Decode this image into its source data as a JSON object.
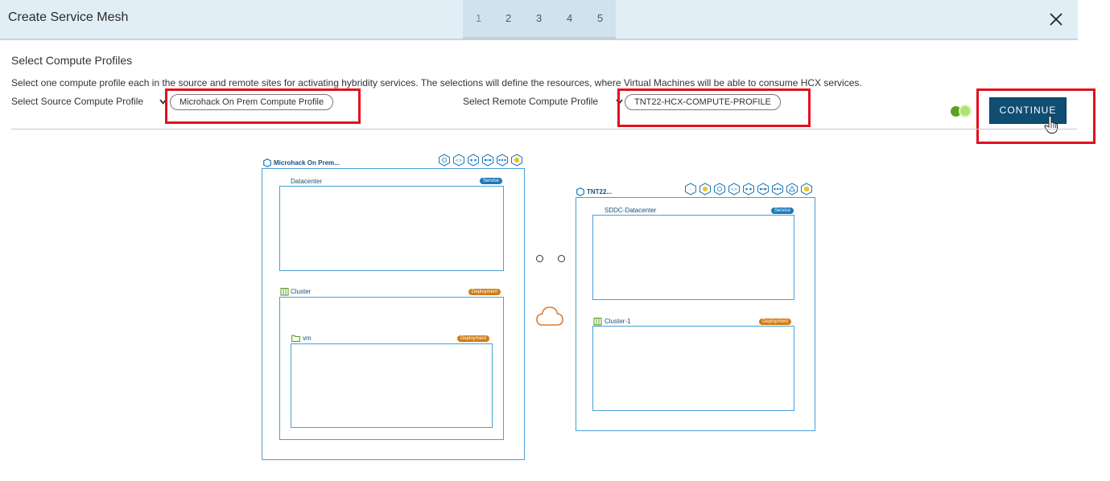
{
  "dialog": {
    "title": "Create Service Mesh",
    "steps": [
      "1",
      "2",
      "3",
      "4",
      "5"
    ],
    "active_step": "1"
  },
  "section": {
    "title": "Select Compute Profiles",
    "description": "Select one compute profile each in the source and remote sites for activating hybridity services. The selections will define the resources, where Virtual Machines will be able to consume HCX services.",
    "source_label": "Select Source Compute Profile",
    "source_value": "Microhack On Prem Compute Profile",
    "remote_label": "Select Remote Compute Profile",
    "remote_value": "TNT22-HCX-COMPUTE-PROFILE",
    "continue_label": "CONTINUE"
  },
  "diagram": {
    "source": {
      "name": "Microhack On Prem...",
      "datacenter": "Datacenter",
      "datacenter_badge": "Service",
      "cluster": "Cluster",
      "cluster_badge": "Deployment",
      "folder": "vm",
      "folder_badge": "Deployment"
    },
    "remote": {
      "name": "TNT22...",
      "datacenter": "SDDC-Datacenter",
      "datacenter_badge": "Service",
      "cluster": "Cluster-1",
      "cluster_badge": "Deployment"
    }
  },
  "colors": {
    "accent": "#0f4d73",
    "highlight": "#e3101f",
    "service_badge": "#1d79b8",
    "deployment_badge": "#cf7c14",
    "cloud": "#e07a2e",
    "toggle": "#5aa220"
  },
  "icons": [
    "close-icon",
    "caret-down-icon",
    "hand-cursor-icon",
    "cloud-icon",
    "site-icon",
    "cluster-icon",
    "folder-icon",
    "service-icon"
  ]
}
